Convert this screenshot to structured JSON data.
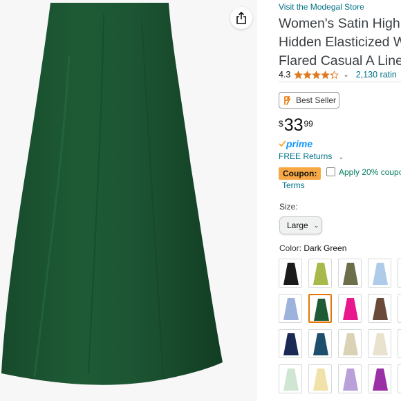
{
  "store": {
    "link_text": "Visit the Modegal Store"
  },
  "product": {
    "title_lines": [
      "Women's Satin High",
      "Hidden Elasticized W",
      "Flared Casual A Line"
    ]
  },
  "rating": {
    "value": "4.3",
    "stars": 4.3,
    "review_count": "2,130 ratin"
  },
  "badge": {
    "label": "Best Seller"
  },
  "price": {
    "symbol": "$",
    "whole": "33",
    "fraction": "99"
  },
  "delivery": {
    "prime_label": "prime",
    "returns_label": "FREE Returns"
  },
  "coupon": {
    "tag": "Coupon:",
    "apply_text": "Apply 20% coupo",
    "terms_label": "Terms"
  },
  "size": {
    "label": "Size:",
    "selected": "Large"
  },
  "color": {
    "label": "Color:",
    "selected": "Dark Green"
  },
  "image": {
    "skirt_color": "#1e5b35"
  },
  "swatches": [
    [
      "#1b1b1b",
      "#a8b84a",
      "#6d6e4a",
      "#aecbea",
      "#6b4a3c"
    ],
    [
      "#9db3dc",
      "#1e5b35",
      "#e9178c",
      "#6a4b3a",
      "#c9b48e"
    ],
    [
      "#1b2a55",
      "#1d4e6e",
      "#d9d2b4",
      "#e9e2cf",
      "#3c3c3c"
    ],
    [
      "#cfe7d2",
      "#f0e2a8",
      "#b9a0d8",
      "#9b2fa6",
      "#d8b4c4"
    ]
  ]
}
